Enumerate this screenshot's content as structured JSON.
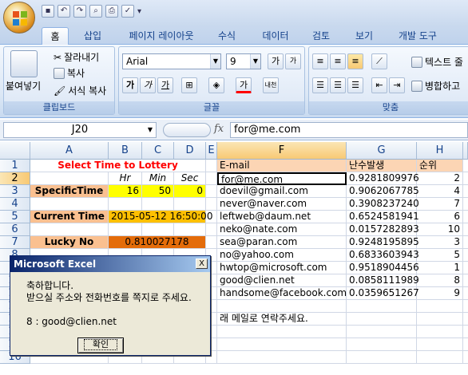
{
  "quick_access": {
    "icons": [
      "save-icon",
      "undo-icon",
      "redo-icon",
      "print-preview-icon",
      "print-icon",
      "spelling-icon"
    ]
  },
  "tabs": [
    "홈",
    "삽입",
    "페이지 레이아웃",
    "수식",
    "데이터",
    "검토",
    "보기",
    "개발 도구"
  ],
  "ribbon": {
    "clipboard": {
      "paste": "붙여넣기",
      "cut": "잘라내기",
      "copy": "복사",
      "format_painter": "서식 복사",
      "label": "클립보드"
    },
    "font": {
      "name": "Arial",
      "size": "9",
      "label": "글꼴",
      "grow": "가",
      "shrink": "가",
      "bold": "가",
      "italic": "가",
      "underline": "가",
      "font_color": "가",
      "phonetic": "내천"
    },
    "alignment": {
      "wrap_text": "텍스트 줄",
      "merge": "병합하고",
      "label": "맞춤"
    }
  },
  "formula_bar": {
    "name_box": "J20",
    "fx": "fx",
    "value": "for@me.com"
  },
  "columns": [
    "A",
    "B",
    "C",
    "D",
    "E",
    "F",
    "G",
    "H"
  ],
  "rows": [
    "1",
    "2",
    "3",
    "4",
    "5",
    "6",
    "7",
    "8",
    "9",
    "10",
    "11",
    "12",
    "13",
    "14",
    "15",
    "16"
  ],
  "sheet": {
    "title": "Select Time to Lottery",
    "hr_label": "Hr",
    "min_label": "Min",
    "sec_label": "Sec",
    "specific_time_label": "SpecificTime",
    "hr": "16",
    "min": "50",
    "sec": "0",
    "current_time_label": "Current Time",
    "current_time": "2015-05-12 16:50:00",
    "lucky_label": "Lucky No",
    "lucky_value": "0.810027178",
    "header_email": "E-mail",
    "header_random": "난수발생",
    "header_rank": "순위",
    "entries": [
      {
        "email": "for@me.com",
        "rand": "0.9281809976",
        "rank": "2"
      },
      {
        "email": "doevil@gmail.com",
        "rand": "0.9062067785",
        "rank": "4"
      },
      {
        "email": "never@naver.com",
        "rand": "0.3908237240",
        "rank": "7"
      },
      {
        "email": "leftweb@daum.net",
        "rand": "0.6524581941",
        "rank": "6"
      },
      {
        "email": "neko@nate.com",
        "rand": "0.0157282893",
        "rank": "10"
      },
      {
        "email": "sea@paran.com",
        "rand": "0.9248195895",
        "rank": "3"
      },
      {
        "email": "no@yahoo.com",
        "rand": "0.6833603943",
        "rank": "5"
      },
      {
        "email": "hwtop@microsoft.com",
        "rand": "0.9518904456",
        "rank": "1"
      },
      {
        "email": "good@clien.net",
        "rand": "0.0858111989",
        "rank": "8"
      },
      {
        "email": "handsome@facebook.com",
        "rand": "0.0359651267",
        "rank": "9"
      }
    ],
    "note": "래 메일로 연락주세요."
  },
  "dialog": {
    "title": "Microsoft Excel",
    "close": "X",
    "message": "축하합니다.\n받으실 주소와 전화번호를 쪽지로 주세요.\n\n8 : good@clien.net",
    "ok": "확인"
  },
  "colors": {
    "title_red": "#ff0000",
    "label_orange": "#fac090",
    "hours_yellow": "#ffff00",
    "time_yellow": "#ffc000",
    "lucky_orange": "#e46c0a",
    "email_header": "#fcd5b4",
    "selection": "#000000"
  }
}
